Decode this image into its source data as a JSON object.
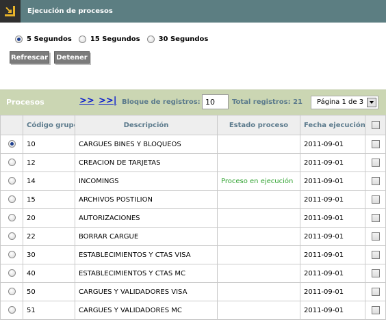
{
  "header": {
    "title": "Ejecución de procesos"
  },
  "refresh_options": [
    {
      "label": "5 Segundos",
      "checked": true
    },
    {
      "label": "15 Segundos",
      "checked": false
    },
    {
      "label": "30 Segundos",
      "checked": false
    }
  ],
  "buttons": {
    "refrescar": "Refrescar",
    "detener": "Detener"
  },
  "toolbar": {
    "title": "Procesos",
    "next": ">>",
    "last": ">>|",
    "block_label": "Bloque de registros:",
    "block_value": "10",
    "total_label": "Total registros:",
    "total_value": "21",
    "page_label": "Página 1 de 3"
  },
  "table": {
    "headers": {
      "code": "Código grupo",
      "description": "Descripción",
      "status": "Estado proceso",
      "date": "Fecha ejecución"
    },
    "rows": [
      {
        "code": "10",
        "description": "CARGUES BINES Y BLOQUEOS",
        "status": "",
        "date": "2011-09-01",
        "selected": true
      },
      {
        "code": "12",
        "description": "CREACION DE TARJETAS",
        "status": "",
        "date": "2011-09-01",
        "selected": false
      },
      {
        "code": "14",
        "description": "INCOMINGS",
        "status": "Proceso en ejecución",
        "date": "2011-09-01",
        "selected": false
      },
      {
        "code": "15",
        "description": "ARCHIVOS POSTILION",
        "status": "",
        "date": "2011-09-01",
        "selected": false
      },
      {
        "code": "20",
        "description": "AUTORIZACIONES",
        "status": "",
        "date": "2011-09-01",
        "selected": false
      },
      {
        "code": "22",
        "description": "BORRAR CARGUE",
        "status": "",
        "date": "2011-09-01",
        "selected": false
      },
      {
        "code": "30",
        "description": "ESTABLECIMIENTOS Y CTAS VISA",
        "status": "",
        "date": "2011-09-01",
        "selected": false
      },
      {
        "code": "40",
        "description": "ESTABLECIMIENTOS Y CTAS MC",
        "status": "",
        "date": "2011-09-01",
        "selected": false
      },
      {
        "code": "50",
        "description": "CARGUES Y VALIDADORES VISA",
        "status": "",
        "date": "2011-09-01",
        "selected": false
      },
      {
        "code": "51",
        "description": "CARGUES Y VALIDADORES MC",
        "status": "",
        "date": "2011-09-01",
        "selected": false
      }
    ]
  },
  "colors": {
    "header_bar": "#5c7e82",
    "toolbar": "#cbd6b3",
    "status_running": "#2ea12e",
    "link": "#1122cc"
  }
}
